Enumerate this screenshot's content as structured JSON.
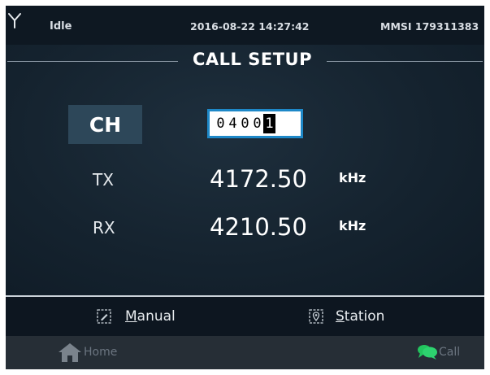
{
  "status": {
    "state": "Idle",
    "datetime": "2016-08-22 14:27:42",
    "mmsi": "MMSI 179311383"
  },
  "screen": {
    "title": "CALL SETUP"
  },
  "channel": {
    "label": "CH",
    "digits": [
      "0",
      "4",
      "0",
      "0",
      "1"
    ]
  },
  "frequencies": {
    "tx": {
      "label": "TX",
      "value": "4172.50",
      "unit": "kHz"
    },
    "rx": {
      "label": "RX",
      "value": "4210.50",
      "unit": "kHz"
    }
  },
  "actions": {
    "manual": {
      "accel": "M",
      "rest": "anual",
      "icon": "edit-icon"
    },
    "station": {
      "accel": "S",
      "rest": "tation",
      "icon": "location-pin-icon"
    }
  },
  "nav": {
    "home": {
      "label": "Home",
      "icon": "home-icon"
    },
    "call": {
      "label": "Call",
      "icon": "chat-bubbles-icon"
    }
  },
  "colors": {
    "background": "#0f1b26",
    "channel_label_bg": "#2d4759",
    "field_border": "#1e88c8",
    "call_icon": "#22c55e",
    "disabled_text": "#6b7580"
  }
}
